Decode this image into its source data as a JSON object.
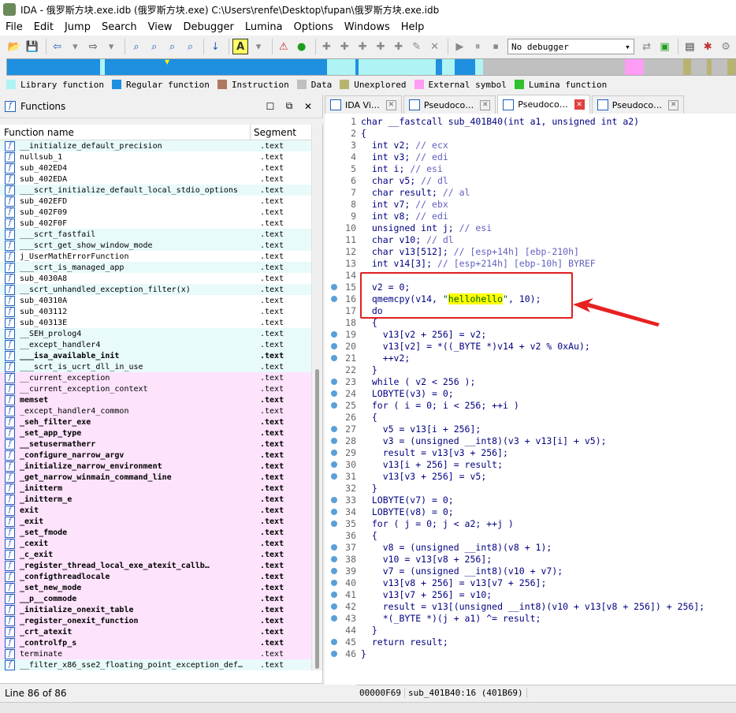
{
  "window": {
    "title": "IDA - 俄罗斯方块.exe.idb (俄罗斯方块.exe) C:\\Users\\renfe\\Desktop\\fupan\\俄罗斯方块.exe.idb"
  },
  "menu": [
    "File",
    "Edit",
    "Jump",
    "Search",
    "View",
    "Debugger",
    "Lumina",
    "Options",
    "Windows",
    "Help"
  ],
  "toolbar": {
    "debugger_value": "No debugger"
  },
  "legend": [
    {
      "label": "Library function",
      "color": "#aef4f4"
    },
    {
      "label": "Regular function",
      "color": "#1f8fe0"
    },
    {
      "label": "Instruction",
      "color": "#b07860"
    },
    {
      "label": "Data",
      "color": "#c0c0c0"
    },
    {
      "label": "Unexplored",
      "color": "#b8b470"
    },
    {
      "label": "External symbol",
      "color": "#ff9cf5"
    },
    {
      "label": "Lumina function",
      "color": "#30c030"
    }
  ],
  "functions_panel": {
    "title": "Functions",
    "col_name": "Function name",
    "col_segment": "Segment",
    "status": "Line 86 of 86",
    "rows": [
      {
        "name": "__initialize_default_precision",
        "seg": ".text",
        "kind": "lib",
        "bold": false
      },
      {
        "name": "nullsub_1",
        "seg": ".text",
        "kind": "sel",
        "bold": false
      },
      {
        "name": "sub_402ED4",
        "seg": ".text",
        "kind": "sel",
        "bold": false
      },
      {
        "name": "sub_402EDA",
        "seg": ".text",
        "kind": "sel",
        "bold": false
      },
      {
        "name": "___scrt_initialize_default_local_stdio_options",
        "seg": ".text",
        "kind": "lib",
        "bold": false
      },
      {
        "name": "sub_402EFD",
        "seg": ".text",
        "kind": "sel",
        "bold": false
      },
      {
        "name": "sub_402F09",
        "seg": ".text",
        "kind": "sel",
        "bold": false
      },
      {
        "name": "sub_402F0F",
        "seg": ".text",
        "kind": "sel",
        "bold": false
      },
      {
        "name": "___scrt_fastfail",
        "seg": ".text",
        "kind": "lib",
        "bold": false
      },
      {
        "name": "___scrt_get_show_window_mode",
        "seg": ".text",
        "kind": "lib",
        "bold": false
      },
      {
        "name": "j_UserMathErrorFunction",
        "seg": ".text",
        "kind": "sel",
        "bold": false
      },
      {
        "name": "___scrt_is_managed_app",
        "seg": ".text",
        "kind": "lib",
        "bold": false
      },
      {
        "name": "sub_4030A8",
        "seg": ".text",
        "kind": "sel",
        "bold": false
      },
      {
        "name": "__scrt_unhandled_exception_filter(x)",
        "seg": ".text",
        "kind": "lib",
        "bold": false
      },
      {
        "name": "sub_40310A",
        "seg": ".text",
        "kind": "sel",
        "bold": false
      },
      {
        "name": "sub_403112",
        "seg": ".text",
        "kind": "sel",
        "bold": false
      },
      {
        "name": "sub_40313E",
        "seg": ".text",
        "kind": "sel",
        "bold": false
      },
      {
        "name": "__SEH_prolog4",
        "seg": ".text",
        "kind": "lib",
        "bold": false
      },
      {
        "name": "__except_handler4",
        "seg": ".text",
        "kind": "lib",
        "bold": false
      },
      {
        "name": "___isa_available_init",
        "seg": ".text",
        "kind": "lib",
        "bold": true
      },
      {
        "name": "___scrt_is_ucrt_dll_in_use",
        "seg": ".text",
        "kind": "lib",
        "bold": false
      },
      {
        "name": "__current_exception",
        "seg": ".text",
        "kind": "ext",
        "bold": false
      },
      {
        "name": "__current_exception_context",
        "seg": ".text",
        "kind": "ext",
        "bold": false
      },
      {
        "name": "memset",
        "seg": ".text",
        "kind": "ext",
        "bold": true
      },
      {
        "name": "_except_handler4_common",
        "seg": ".text",
        "kind": "ext",
        "bold": false
      },
      {
        "name": "_seh_filter_exe",
        "seg": ".text",
        "kind": "ext",
        "bold": true
      },
      {
        "name": "_set_app_type",
        "seg": ".text",
        "kind": "ext",
        "bold": true
      },
      {
        "name": "__setusermatherr",
        "seg": ".text",
        "kind": "ext",
        "bold": true
      },
      {
        "name": "_configure_narrow_argv",
        "seg": ".text",
        "kind": "ext",
        "bold": true
      },
      {
        "name": "_initialize_narrow_environment",
        "seg": ".text",
        "kind": "ext",
        "bold": true
      },
      {
        "name": "_get_narrow_winmain_command_line",
        "seg": ".text",
        "kind": "ext",
        "bold": true
      },
      {
        "name": "_initterm",
        "seg": ".text",
        "kind": "ext",
        "bold": true
      },
      {
        "name": "_initterm_e",
        "seg": ".text",
        "kind": "ext",
        "bold": true
      },
      {
        "name": "exit",
        "seg": ".text",
        "kind": "ext",
        "bold": true
      },
      {
        "name": "_exit",
        "seg": ".text",
        "kind": "ext",
        "bold": true
      },
      {
        "name": "_set_fmode",
        "seg": ".text",
        "kind": "ext",
        "bold": true
      },
      {
        "name": "_cexit",
        "seg": ".text",
        "kind": "ext",
        "bold": true
      },
      {
        "name": "_c_exit",
        "seg": ".text",
        "kind": "ext",
        "bold": true
      },
      {
        "name": "_register_thread_local_exe_atexit_callb…",
        "seg": ".text",
        "kind": "ext",
        "bold": true
      },
      {
        "name": "_configthreadlocale",
        "seg": ".text",
        "kind": "ext",
        "bold": true
      },
      {
        "name": "_set_new_mode",
        "seg": ".text",
        "kind": "ext",
        "bold": true
      },
      {
        "name": "__p__commode",
        "seg": ".text",
        "kind": "ext",
        "bold": true
      },
      {
        "name": "_initialize_onexit_table",
        "seg": ".text",
        "kind": "ext",
        "bold": true
      },
      {
        "name": "_register_onexit_function",
        "seg": ".text",
        "kind": "ext",
        "bold": true
      },
      {
        "name": "_crt_atexit",
        "seg": ".text",
        "kind": "ext",
        "bold": true
      },
      {
        "name": "_controlfp_s",
        "seg": ".text",
        "kind": "ext",
        "bold": true
      },
      {
        "name": "terminate",
        "seg": ".text",
        "kind": "ext",
        "bold": false
      },
      {
        "name": "__filter_x86_sse2_floating_point_exception_def…",
        "seg": ".text",
        "kind": "lib",
        "bold": false
      }
    ]
  },
  "tabs": [
    {
      "label": "IDA Vi…",
      "active": false
    },
    {
      "label": "Pseudoco…",
      "active": false
    },
    {
      "label": "Pseudoco…",
      "active": true
    },
    {
      "label": "Pseudoco…",
      "active": false
    }
  ],
  "code": {
    "lines": [
      {
        "n": "1",
        "dot": false,
        "text": "char __fastcall sub_401B40(int a1, unsigned int a2)"
      },
      {
        "n": "2",
        "dot": false,
        "text": "{"
      },
      {
        "n": "3",
        "dot": false,
        "text": "  int v2; // ecx"
      },
      {
        "n": "4",
        "dot": false,
        "text": "  int v3; // edi"
      },
      {
        "n": "5",
        "dot": false,
        "text": "  int i; // esi"
      },
      {
        "n": "6",
        "dot": false,
        "text": "  char v5; // dl"
      },
      {
        "n": "7",
        "dot": false,
        "text": "  char result; // al"
      },
      {
        "n": "8",
        "dot": false,
        "text": "  int v7; // ebx"
      },
      {
        "n": "9",
        "dot": false,
        "text": "  int v8; // edi"
      },
      {
        "n": "10",
        "dot": false,
        "text": "  unsigned int j; // esi"
      },
      {
        "n": "11",
        "dot": false,
        "text": "  char v10; // dl"
      },
      {
        "n": "12",
        "dot": false,
        "text": "  char v13[512]; // [esp+14h] [ebp-210h]"
      },
      {
        "n": "13",
        "dot": false,
        "text": "  int v14[3]; // [esp+214h] [ebp-10h] BYREF"
      },
      {
        "n": "14",
        "dot": false,
        "text": ""
      },
      {
        "n": "15",
        "dot": true,
        "text": "  v2 = 0;"
      },
      {
        "n": "16",
        "dot": true,
        "text": "  qmemcpy(v14, \"hellohello\", 10);"
      },
      {
        "n": "17",
        "dot": false,
        "text": "  do"
      },
      {
        "n": "18",
        "dot": false,
        "text": "  {"
      },
      {
        "n": "19",
        "dot": true,
        "text": "    v13[v2 + 256] = v2;"
      },
      {
        "n": "20",
        "dot": true,
        "text": "    v13[v2] = *((_BYTE *)v14 + v2 % 0xAu);"
      },
      {
        "n": "21",
        "dot": true,
        "text": "    ++v2;"
      },
      {
        "n": "22",
        "dot": false,
        "text": "  }"
      },
      {
        "n": "23",
        "dot": true,
        "text": "  while ( v2 < 256 );"
      },
      {
        "n": "24",
        "dot": true,
        "text": "  LOBYTE(v3) = 0;"
      },
      {
        "n": "25",
        "dot": true,
        "text": "  for ( i = 0; i < 256; ++i )"
      },
      {
        "n": "26",
        "dot": false,
        "text": "  {"
      },
      {
        "n": "27",
        "dot": true,
        "text": "    v5 = v13[i + 256];"
      },
      {
        "n": "28",
        "dot": true,
        "text": "    v3 = (unsigned __int8)(v3 + v13[i] + v5);"
      },
      {
        "n": "29",
        "dot": true,
        "text": "    result = v13[v3 + 256];"
      },
      {
        "n": "30",
        "dot": true,
        "text": "    v13[i + 256] = result;"
      },
      {
        "n": "31",
        "dot": true,
        "text": "    v13[v3 + 256] = v5;"
      },
      {
        "n": "32",
        "dot": false,
        "text": "  }"
      },
      {
        "n": "33",
        "dot": true,
        "text": "  LOBYTE(v7) = 0;"
      },
      {
        "n": "34",
        "dot": true,
        "text": "  LOBYTE(v8) = 0;"
      },
      {
        "n": "35",
        "dot": true,
        "text": "  for ( j = 0; j < a2; ++j )"
      },
      {
        "n": "36",
        "dot": false,
        "text": "  {"
      },
      {
        "n": "37",
        "dot": true,
        "text": "    v8 = (unsigned __int8)(v8 + 1);"
      },
      {
        "n": "38",
        "dot": true,
        "text": "    v10 = v13[v8 + 256];"
      },
      {
        "n": "39",
        "dot": true,
        "text": "    v7 = (unsigned __int8)(v10 + v7);"
      },
      {
        "n": "40",
        "dot": true,
        "text": "    v13[v8 + 256] = v13[v7 + 256];"
      },
      {
        "n": "41",
        "dot": true,
        "text": "    v13[v7 + 256] = v10;"
      },
      {
        "n": "42",
        "dot": true,
        "text": "    result = v13[(unsigned __int8)(v10 + v13[v8 + 256]) + 256];"
      },
      {
        "n": "43",
        "dot": true,
        "text": "    *(_BYTE *)(j + a1) ^= result;"
      },
      {
        "n": "44",
        "dot": false,
        "text": "  }"
      },
      {
        "n": "45",
        "dot": true,
        "text": "  return result;"
      },
      {
        "n": "46",
        "dot": true,
        "text": "}"
      }
    ]
  },
  "code_status": {
    "address": "00000F69",
    "location": "sub_401B40:16 (401B69)"
  }
}
